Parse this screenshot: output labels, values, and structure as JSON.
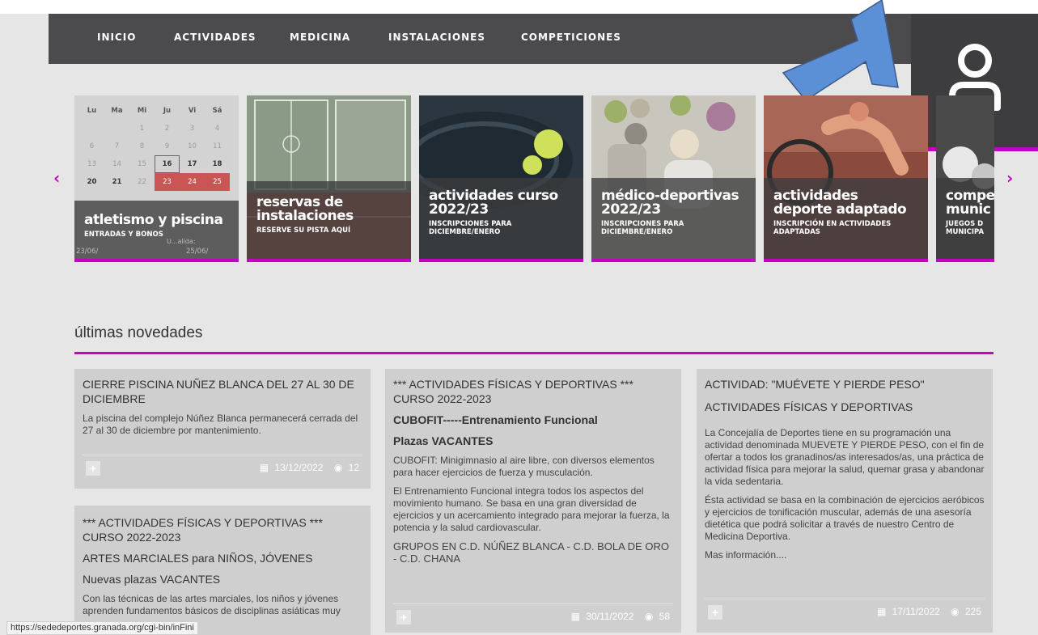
{
  "nav": {
    "items": [
      "INICIO",
      "ACTIVIDADES",
      "MEDICINA",
      "INSTALACIONES",
      "COMPETICIONES"
    ]
  },
  "icons": {
    "user": "user-icon",
    "prev": "chevron-left-icon",
    "next": "chevron-right-icon",
    "calendar": "calendar-icon",
    "views": "eye-icon",
    "plus": "plus-icon"
  },
  "colors": {
    "accent": "#c300c3",
    "navbar": "#4b4b4d",
    "annotation_arrow": "#5b8fd6"
  },
  "carousel": {
    "prev": "‹",
    "next": "›",
    "calendar": {
      "days": [
        "Lu",
        "Ma",
        "Mi",
        "Ju",
        "Vi",
        "Sá"
      ],
      "rows": [
        [
          "",
          "",
          "1",
          "2",
          "3",
          "4"
        ],
        [
          "6",
          "7",
          "8",
          "9",
          "10",
          "11"
        ],
        [
          "13",
          "14",
          "15",
          "16",
          "17",
          "18"
        ],
        [
          "20",
          "21",
          "22",
          "23",
          "24",
          "25"
        ]
      ],
      "dates_left": "23/06/",
      "dates_right": "25/06/",
      "validity": "U...alida:"
    },
    "cards": [
      {
        "title": "atletismo y piscina",
        "subtitle": "ENTRADAS Y BONOS"
      },
      {
        "title": "reservas de instalaciones",
        "subtitle": "RESERVE SU PISTA AQUÍ"
      },
      {
        "title": "actividades curso 2022/23",
        "subtitle": "INSCRIPCIONES PARA DICIEMBRE/ENERO"
      },
      {
        "title": "médico-deportivas 2022/23",
        "subtitle": "INSCRIPCIONES PARA DICIEMBRE/ENERO"
      },
      {
        "title": "actividades deporte adaptado",
        "subtitle": "INSCRIPCIÓN EN ACTIVIDADES ADAPTADAS"
      },
      {
        "title": "compe munic",
        "subtitle": "JUEGOS D MUNICIPA"
      }
    ]
  },
  "section": {
    "title": "últimas novedades"
  },
  "news": [
    {
      "title": "CIERRE PISCINA NUÑEZ BLANCA DEL 27 AL 30 DE DICIEMBRE",
      "body": "La piscina del complejo Núñez Blanca permanecerá cerrada del 27 al 30 de diciembre por mantenimiento.",
      "date": "13/12/2022",
      "views": "12"
    },
    {
      "title": "*** ACTIVIDADES FÍSICAS Y DEPORTIVAS *** CURSO 2022-2023",
      "sub1": "ARTES MARCIALES para NIÑOS, JÓVENES",
      "sub2": "Nuevas plazas VACANTES",
      "body": "Con las técnicas de las artes marciales, los niños y jóvenes aprenden fundamentos básicos de disciplinas asiáticas muy"
    },
    {
      "title": "*** ACTIVIDADES FÍSICAS Y DEPORTIVAS *** CURSO 2022-2023",
      "sub1": "CUBOFIT-----Entrenamiento Funcional",
      "sub2": "Plazas VACANTES",
      "p1": "CUBOFIT: Minigimnasio al aire libre, con diversos elementos para hacer ejercicios de fuerza y musculación.",
      "p2": "El Entrenamiento Funcional integra todos los aspectos del movimiento humano. Se basa en una gran diversidad de ejercicios y un acercamiento integrado para mejorar la fuerza, la potencia y la salud cardiovascular.",
      "p3": "GRUPOS EN C.D. NÚÑEZ BLANCA - C.D. BOLA DE ORO - C.D. CHANA",
      "date": "30/11/2022",
      "views": "58"
    },
    {
      "title": "ACTIVIDAD: \"MUÉVETE Y PIERDE PESO\"",
      "sub1": "ACTIVIDADES FÍSICAS Y DEPORTIVAS",
      "p1": "La Concejalía de Deportes tiene en su programación una actividad denominada MUEVETE Y PIERDE PESO, con el fin de ofertar a todos los granadinos/as interesados/as, una práctica de actividad física para mejorar la salud, quemar grasa y abandonar la vida sedentaria.",
      "p2": "Ésta actividad se basa en la combinación de ejercicios aeróbicos y ejercicios de tonificación muscular, además de una asesoría dietética que podrá solicitar a través de nuestro Centro de Medicina Deportiva.",
      "p3": "Mas información....",
      "date": "17/11/2022",
      "views": "225"
    }
  ],
  "status_url": "https://sededeportes.granada.org/cgi-bin/inFini"
}
